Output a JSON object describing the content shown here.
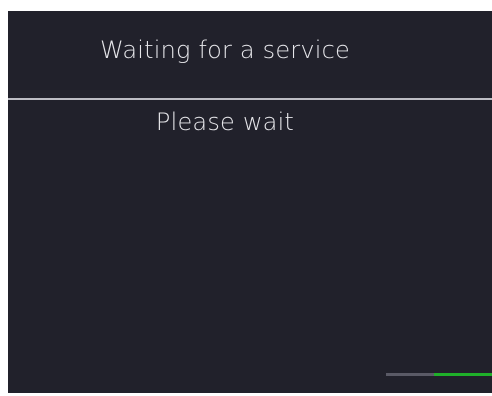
{
  "header": {
    "title": "Waiting for a service"
  },
  "body": {
    "message": "Please wait"
  },
  "progress": {
    "fraction": 0.55,
    "fill_color": "#1fb02a",
    "track_color": "#5a5a66"
  },
  "colors": {
    "background": "#21212b",
    "text": "#e6e6ea",
    "divider": "#bdbdc4"
  }
}
